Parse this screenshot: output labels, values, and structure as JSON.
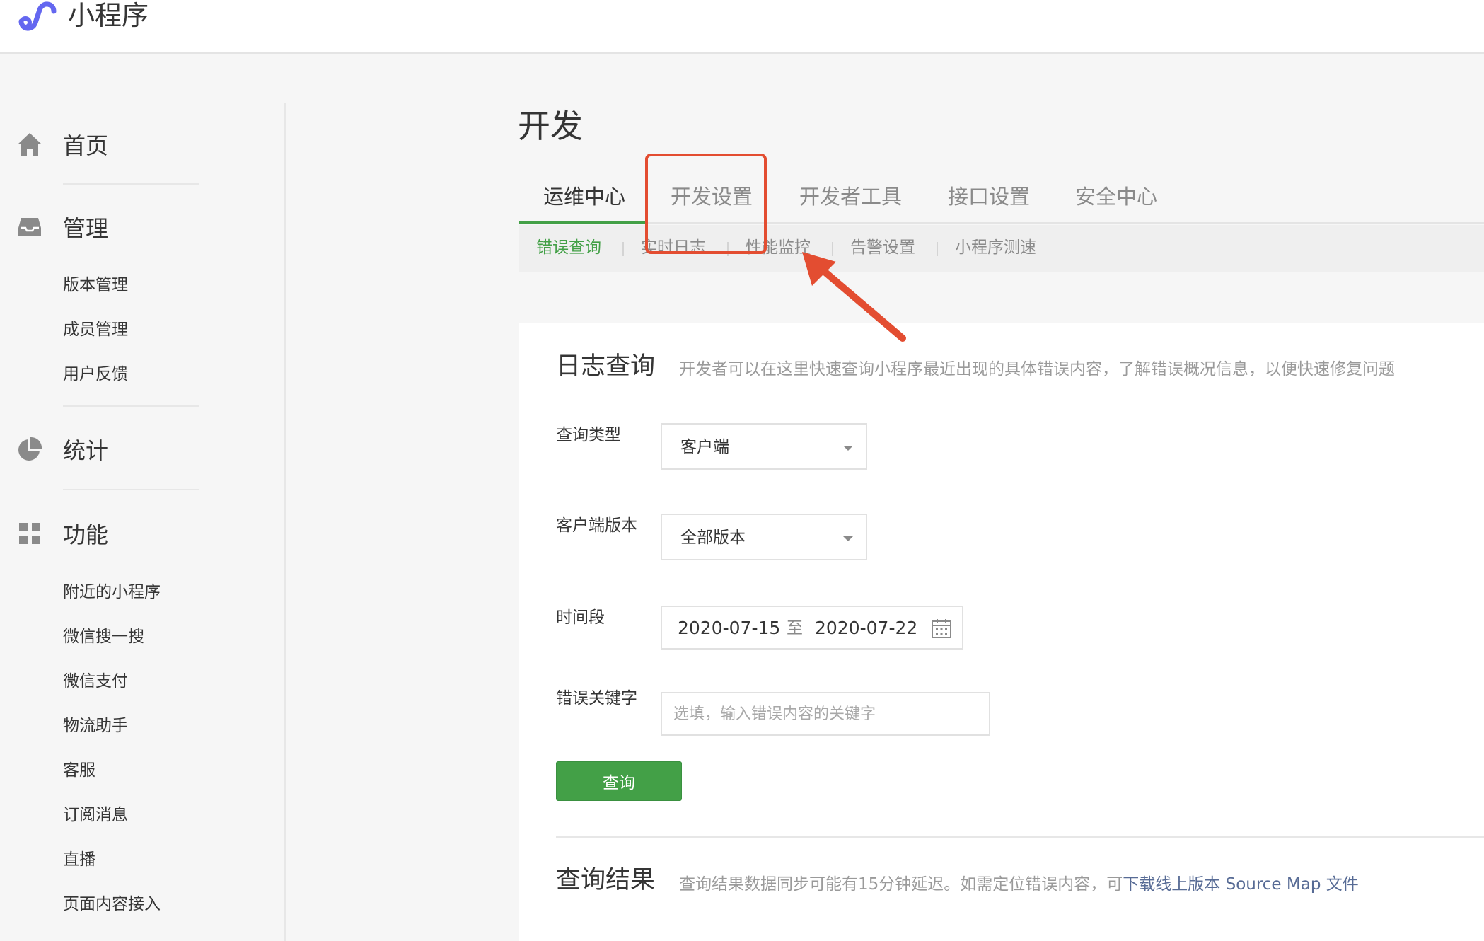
{
  "app": {
    "title": "小程序"
  },
  "colors": {
    "accent_green": "#43a047",
    "highlight_red": "#e34d31",
    "logo_purple": "#6467f0",
    "link_blue": "#576b95"
  },
  "sidebar": {
    "home": {
      "label": "首页",
      "icon": "home-icon"
    },
    "manage": {
      "label": "管理",
      "icon": "inbox-icon",
      "items": [
        "版本管理",
        "成员管理",
        "用户反馈"
      ]
    },
    "stats": {
      "label": "统计",
      "icon": "pie-chart-icon"
    },
    "features": {
      "label": "功能",
      "icon": "grid-icon",
      "items": [
        "附近的小程序",
        "微信搜一搜",
        "微信支付",
        "物流助手",
        "客服",
        "订阅消息",
        "直播",
        "页面内容接入"
      ]
    }
  },
  "page": {
    "title": "开发"
  },
  "tabs": [
    "运维中心",
    "开发设置",
    "开发者工具",
    "接口设置",
    "安全中心"
  ],
  "active_tab": "运维中心",
  "subtabs": [
    "错误查询",
    "实时日志",
    "性能监控",
    "告警设置",
    "小程序测速"
  ],
  "active_subtab": "错误查询",
  "log_query": {
    "title": "日志查询",
    "description": "开发者可以在这里快速查询小程序最近出现的具体错误内容，了解错误概况信息，以便快速修复问题",
    "query_type": {
      "label": "查询类型",
      "value": "客户端"
    },
    "client_version": {
      "label": "客户端版本",
      "value": "全部版本"
    },
    "time_range": {
      "label": "时间段",
      "start": "2020-07-15",
      "separator": "至",
      "end": "2020-07-22"
    },
    "keyword": {
      "label": "错误关键字",
      "placeholder": "选填，输入错误内容的关键字"
    },
    "query_button": "查询"
  },
  "results": {
    "title": "查询结果",
    "description": "查询结果数据同步可能有15分钟延迟。如需定位错误内容，可",
    "link": "下载线上版本 Source Map 文件"
  }
}
